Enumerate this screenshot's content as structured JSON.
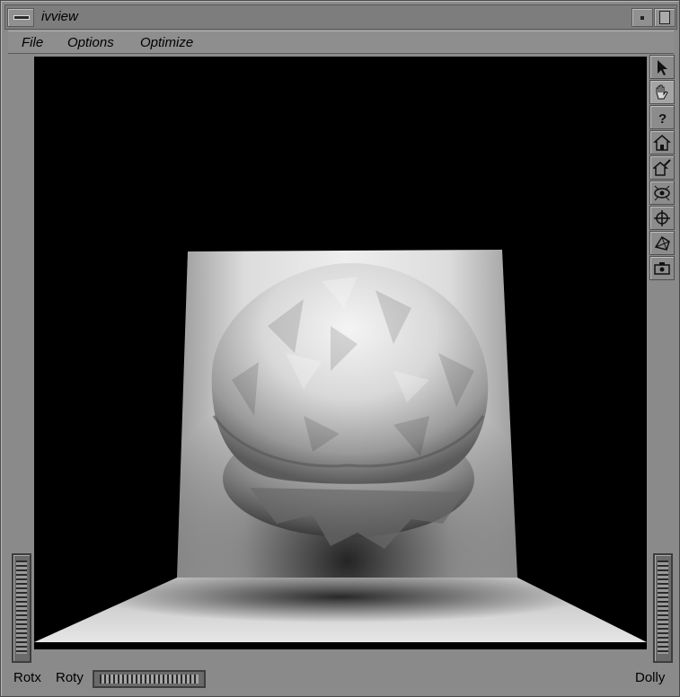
{
  "window": {
    "title": "ivview"
  },
  "menubar": {
    "items": [
      "File",
      "Options",
      "Optimize"
    ]
  },
  "toolbar": {
    "tools": [
      "select-arrow-icon",
      "view-hand-icon",
      "help-question-icon",
      "home-icon",
      "set-home-icon",
      "view-all-icon",
      "seek-crosshair-icon",
      "perspective-icon",
      "camera-icon"
    ],
    "active": "view-hand-icon"
  },
  "thumbwheels": {
    "rotx_label": "Rotx",
    "roty_label": "Roty",
    "dolly_label": "Dolly"
  },
  "viewer": {
    "background": "#000000"
  }
}
